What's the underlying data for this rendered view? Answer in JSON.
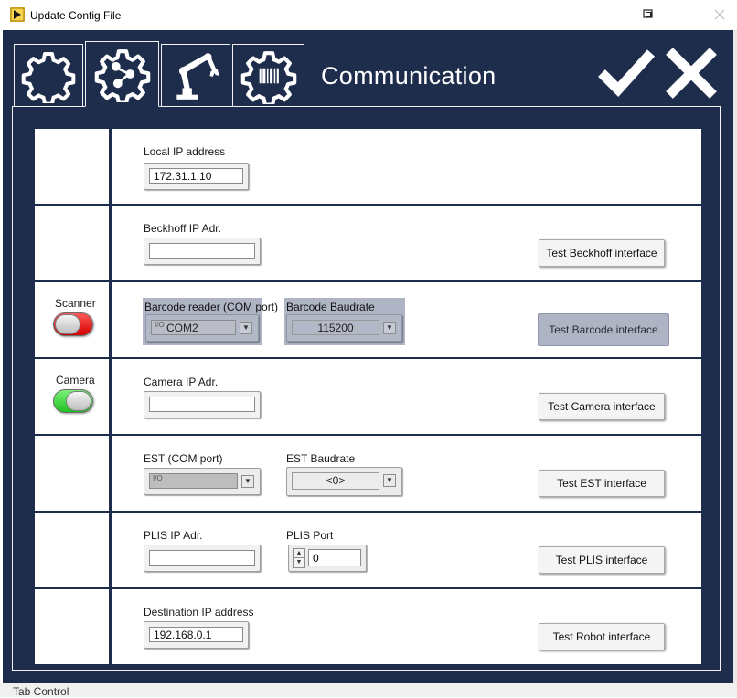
{
  "window": {
    "title": "Update Config File"
  },
  "header": {
    "title": "Communication"
  },
  "tabs": [
    {
      "icon": "gear-icon"
    },
    {
      "icon": "share-network-gear-icon"
    },
    {
      "icon": "robot-arm-icon"
    },
    {
      "icon": "barcode-gear-icon"
    }
  ],
  "rows": {
    "local_ip": {
      "label": "Local IP address",
      "value": "172.31.1.10"
    },
    "beckhoff": {
      "label": "Beckhoff IP Adr.",
      "value": "",
      "button": "Test Beckhoff interface"
    },
    "barcode": {
      "side_label": "Scanner",
      "toggle": "off",
      "port_label": "Barcode reader (COM port)",
      "port_value": "COM2",
      "baud_label": "Barcode Baudrate",
      "baud_value": "115200",
      "button": "Test Barcode interface"
    },
    "camera": {
      "side_label": "Camera",
      "toggle": "on",
      "label": "Camera IP Adr.",
      "value": "",
      "button": "Test Camera interface"
    },
    "est": {
      "port_label": "EST (COM port)",
      "port_value": "",
      "baud_label": "EST Baudrate",
      "baud_value": "<0>",
      "button": "Test EST interface"
    },
    "plis": {
      "ip_label": "PLIS IP Adr.",
      "ip_value": "",
      "port_label": "PLIS Port",
      "port_value": "0",
      "button": "Test PLIS interface"
    },
    "robot": {
      "label": "Destination IP address",
      "value": "192.168.0.1",
      "button": "Test Robot interface"
    }
  },
  "footer": {
    "label": "Tab Control"
  },
  "io_glyph": "I/O",
  "colors": {
    "background": "#1f2d4d",
    "toggle_off": "#e00000",
    "toggle_on": "#2ed12e",
    "highlight": "#aeb4c4"
  }
}
